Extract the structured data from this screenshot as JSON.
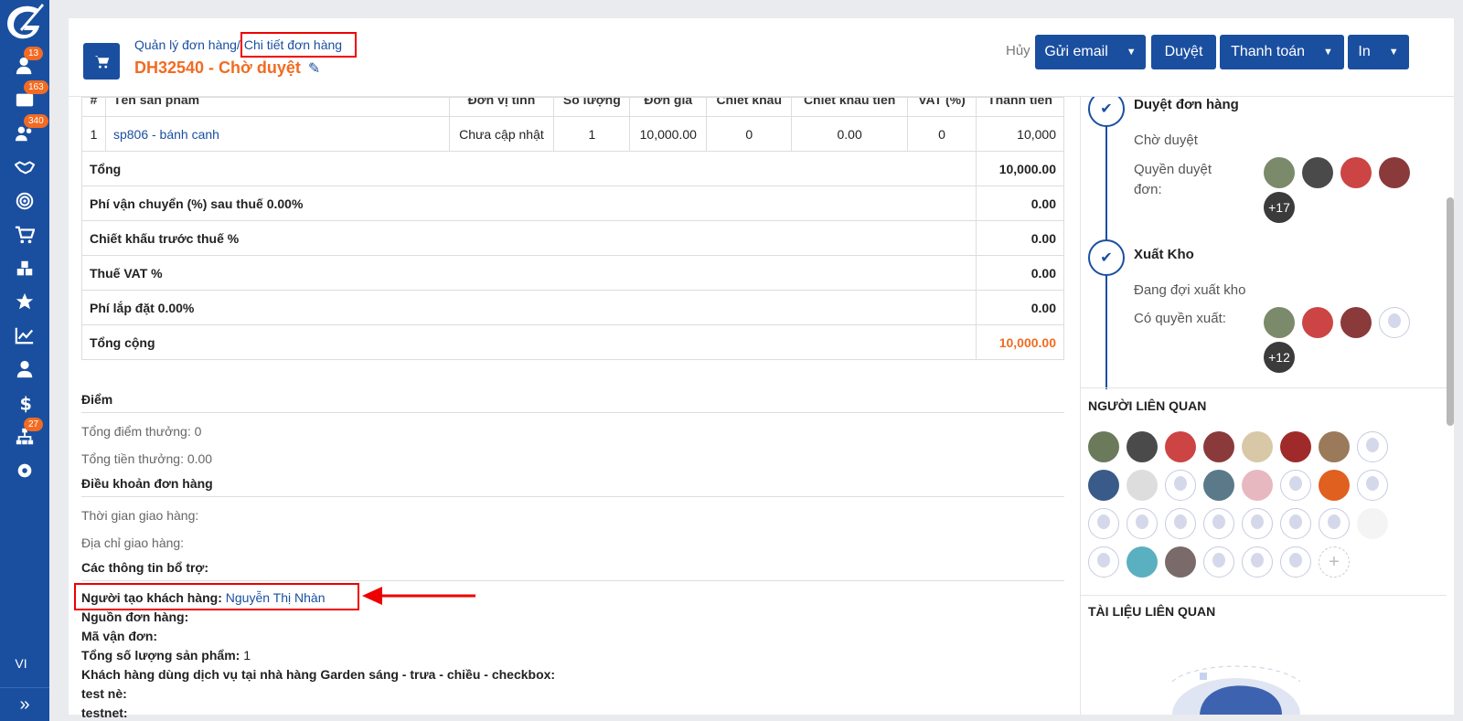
{
  "sidebar": {
    "badges": {
      "users": "13",
      "mail": "163",
      "contacts": "340",
      "hierarchy": "27"
    },
    "lang": "VI",
    "expand_glyph": "»"
  },
  "header": {
    "breadcrumb_root": "Quản lý đơn hàng/",
    "breadcrumb_current": "Chi tiết đơn hàng",
    "order_title": "DH32540 - Chờ duyệt",
    "cancel": "Hủy",
    "buttons": {
      "email": "Gửi email",
      "approve": "Duyệt",
      "payment": "Thanh toán",
      "print": "In"
    }
  },
  "table": {
    "columns": [
      "#",
      "Tên sản phẩm",
      "Đơn vị tính",
      "Số lượng",
      "Đơn giá",
      "Chiết khấu",
      "Chiết khấu tiền",
      "VAT (%)",
      "Thành tiền"
    ],
    "rows": [
      {
        "no": "1",
        "name": "sp806 - bánh canh",
        "unit": "Chưa cập nhật",
        "qty": "1",
        "price": "10,000.00",
        "discount": "0",
        "discount_amount": "0.00",
        "vat": "0",
        "total": "10,000"
      }
    ],
    "summary": [
      {
        "label": "Tổng",
        "value": "10,000.00"
      },
      {
        "label": "Phí vận chuyển (%) sau thuế 0.00%",
        "value": "0.00"
      },
      {
        "label": "Chiết khấu trước thuế %",
        "value": "0.00"
      },
      {
        "label": "Thuế VAT %",
        "value": "0.00"
      },
      {
        "label": "Phí lắp đặt 0.00%",
        "value": "0.00"
      },
      {
        "label": "Tổng cộng",
        "value": "10,000.00"
      }
    ]
  },
  "points": {
    "title": "Điểm",
    "total_points": "Tổng điểm thưởng: 0",
    "total_bonus": "Tổng tiền thưởng: 0.00"
  },
  "terms": {
    "title": "Điều khoản đơn hàng",
    "delivery_time": "Thời gian giao hàng:",
    "delivery_address": "Địa chỉ giao hàng:"
  },
  "extra": {
    "title": "Các thông tin bổ trợ:",
    "creator_label": "Người tạo khách hàng:",
    "creator_value": "Nguyễn Thị Nhàn",
    "source_label": "Nguồn đơn hàng:",
    "tracking_label": "Mã vận đơn:",
    "qty_label": "Tổng số lượng sản phẩm:",
    "qty_value": "1",
    "garden_label": "Khách hàng dùng dịch vụ tại nhà hàng Garden sáng - trưa - chiều - checkbox:",
    "test_label": "test nè:",
    "testnet_label": "testnet:"
  },
  "workflow": {
    "step1_title": "Duyệt đơn hàng",
    "step1_status": "Chờ duyệt",
    "step1_perm": "Quyền duyệt đơn:",
    "step1_more": "+17",
    "step2_title": "Xuất Kho",
    "step2_status": "Đang đợi xuất kho",
    "step2_perm": "Có quyền xuất:",
    "step2_more": "+12"
  },
  "related_people_title": "NGƯỜI LIÊN QUAN",
  "related_docs_title": "TÀI LIỆU LIÊN QUAN",
  "colors": {
    "primary": "#1a4fa0",
    "accent": "#f26b22",
    "annotation": "#ee0000"
  }
}
